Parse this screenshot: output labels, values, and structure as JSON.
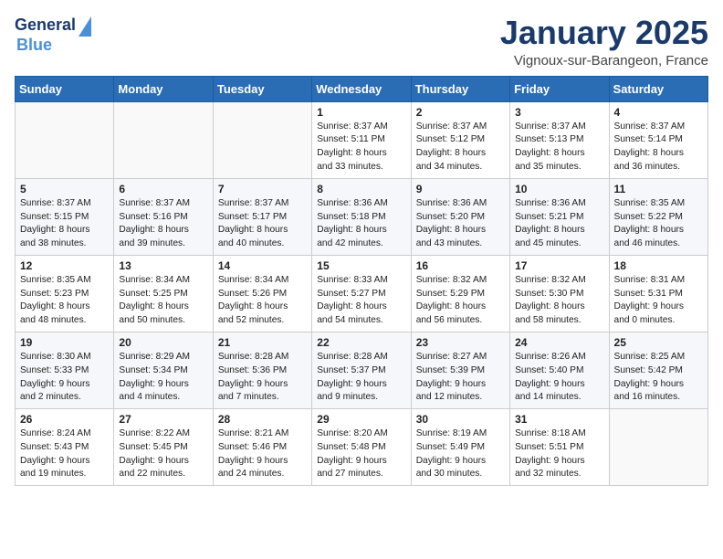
{
  "header": {
    "logo_line1": "General",
    "logo_line2": "Blue",
    "month": "January 2025",
    "location": "Vignoux-sur-Barangeon, France"
  },
  "weekdays": [
    "Sunday",
    "Monday",
    "Tuesday",
    "Wednesday",
    "Thursday",
    "Friday",
    "Saturday"
  ],
  "weeks": [
    [
      {
        "day": "",
        "content": ""
      },
      {
        "day": "",
        "content": ""
      },
      {
        "day": "",
        "content": ""
      },
      {
        "day": "1",
        "content": "Sunrise: 8:37 AM\nSunset: 5:11 PM\nDaylight: 8 hours\nand 33 minutes."
      },
      {
        "day": "2",
        "content": "Sunrise: 8:37 AM\nSunset: 5:12 PM\nDaylight: 8 hours\nand 34 minutes."
      },
      {
        "day": "3",
        "content": "Sunrise: 8:37 AM\nSunset: 5:13 PM\nDaylight: 8 hours\nand 35 minutes."
      },
      {
        "day": "4",
        "content": "Sunrise: 8:37 AM\nSunset: 5:14 PM\nDaylight: 8 hours\nand 36 minutes."
      }
    ],
    [
      {
        "day": "5",
        "content": "Sunrise: 8:37 AM\nSunset: 5:15 PM\nDaylight: 8 hours\nand 38 minutes."
      },
      {
        "day": "6",
        "content": "Sunrise: 8:37 AM\nSunset: 5:16 PM\nDaylight: 8 hours\nand 39 minutes."
      },
      {
        "day": "7",
        "content": "Sunrise: 8:37 AM\nSunset: 5:17 PM\nDaylight: 8 hours\nand 40 minutes."
      },
      {
        "day": "8",
        "content": "Sunrise: 8:36 AM\nSunset: 5:18 PM\nDaylight: 8 hours\nand 42 minutes."
      },
      {
        "day": "9",
        "content": "Sunrise: 8:36 AM\nSunset: 5:20 PM\nDaylight: 8 hours\nand 43 minutes."
      },
      {
        "day": "10",
        "content": "Sunrise: 8:36 AM\nSunset: 5:21 PM\nDaylight: 8 hours\nand 45 minutes."
      },
      {
        "day": "11",
        "content": "Sunrise: 8:35 AM\nSunset: 5:22 PM\nDaylight: 8 hours\nand 46 minutes."
      }
    ],
    [
      {
        "day": "12",
        "content": "Sunrise: 8:35 AM\nSunset: 5:23 PM\nDaylight: 8 hours\nand 48 minutes."
      },
      {
        "day": "13",
        "content": "Sunrise: 8:34 AM\nSunset: 5:25 PM\nDaylight: 8 hours\nand 50 minutes."
      },
      {
        "day": "14",
        "content": "Sunrise: 8:34 AM\nSunset: 5:26 PM\nDaylight: 8 hours\nand 52 minutes."
      },
      {
        "day": "15",
        "content": "Sunrise: 8:33 AM\nSunset: 5:27 PM\nDaylight: 8 hours\nand 54 minutes."
      },
      {
        "day": "16",
        "content": "Sunrise: 8:32 AM\nSunset: 5:29 PM\nDaylight: 8 hours\nand 56 minutes."
      },
      {
        "day": "17",
        "content": "Sunrise: 8:32 AM\nSunset: 5:30 PM\nDaylight: 8 hours\nand 58 minutes."
      },
      {
        "day": "18",
        "content": "Sunrise: 8:31 AM\nSunset: 5:31 PM\nDaylight: 9 hours\nand 0 minutes."
      }
    ],
    [
      {
        "day": "19",
        "content": "Sunrise: 8:30 AM\nSunset: 5:33 PM\nDaylight: 9 hours\nand 2 minutes."
      },
      {
        "day": "20",
        "content": "Sunrise: 8:29 AM\nSunset: 5:34 PM\nDaylight: 9 hours\nand 4 minutes."
      },
      {
        "day": "21",
        "content": "Sunrise: 8:28 AM\nSunset: 5:36 PM\nDaylight: 9 hours\nand 7 minutes."
      },
      {
        "day": "22",
        "content": "Sunrise: 8:28 AM\nSunset: 5:37 PM\nDaylight: 9 hours\nand 9 minutes."
      },
      {
        "day": "23",
        "content": "Sunrise: 8:27 AM\nSunset: 5:39 PM\nDaylight: 9 hours\nand 12 minutes."
      },
      {
        "day": "24",
        "content": "Sunrise: 8:26 AM\nSunset: 5:40 PM\nDaylight: 9 hours\nand 14 minutes."
      },
      {
        "day": "25",
        "content": "Sunrise: 8:25 AM\nSunset: 5:42 PM\nDaylight: 9 hours\nand 16 minutes."
      }
    ],
    [
      {
        "day": "26",
        "content": "Sunrise: 8:24 AM\nSunset: 5:43 PM\nDaylight: 9 hours\nand 19 minutes."
      },
      {
        "day": "27",
        "content": "Sunrise: 8:22 AM\nSunset: 5:45 PM\nDaylight: 9 hours\nand 22 minutes."
      },
      {
        "day": "28",
        "content": "Sunrise: 8:21 AM\nSunset: 5:46 PM\nDaylight: 9 hours\nand 24 minutes."
      },
      {
        "day": "29",
        "content": "Sunrise: 8:20 AM\nSunset: 5:48 PM\nDaylight: 9 hours\nand 27 minutes."
      },
      {
        "day": "30",
        "content": "Sunrise: 8:19 AM\nSunset: 5:49 PM\nDaylight: 9 hours\nand 30 minutes."
      },
      {
        "day": "31",
        "content": "Sunrise: 8:18 AM\nSunset: 5:51 PM\nDaylight: 9 hours\nand 32 minutes."
      },
      {
        "day": "",
        "content": ""
      }
    ]
  ]
}
